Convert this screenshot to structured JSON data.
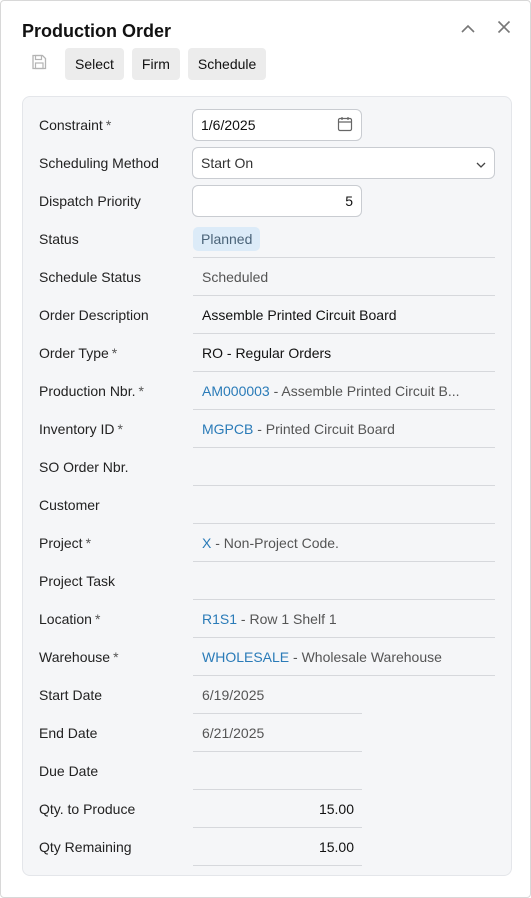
{
  "dialog": {
    "title": "Production Order"
  },
  "toolbar": {
    "select_label": "Select",
    "firm_label": "Firm",
    "schedule_label": "Schedule"
  },
  "form": {
    "constraint": {
      "label": "Constraint",
      "value": "1/6/2025"
    },
    "scheduling_method": {
      "label": "Scheduling Method",
      "value": "Start On"
    },
    "dispatch_priority": {
      "label": "Dispatch Priority",
      "value": "5"
    },
    "status": {
      "label": "Status",
      "value": "Planned"
    },
    "schedule_status": {
      "label": "Schedule Status",
      "value": "Scheduled"
    },
    "order_description": {
      "label": "Order Description",
      "value": "Assemble Printed Circuit Board"
    },
    "order_type": {
      "label": "Order Type",
      "value": "RO - Regular Orders"
    },
    "production_nbr": {
      "label": "Production Nbr.",
      "code": "AM000003",
      "desc": " - Assemble Printed Circuit B..."
    },
    "inventory_id": {
      "label": "Inventory ID",
      "code": "MGPCB",
      "desc": " - Printed Circuit Board"
    },
    "so_order_nbr": {
      "label": "SO Order Nbr.",
      "value": ""
    },
    "customer": {
      "label": "Customer",
      "value": ""
    },
    "project": {
      "label": "Project",
      "code": "X",
      "desc": " - Non-Project Code."
    },
    "project_task": {
      "label": "Project Task",
      "value": ""
    },
    "location": {
      "label": "Location",
      "code": "R1S1",
      "desc": " - Row 1 Shelf 1"
    },
    "warehouse": {
      "label": "Warehouse",
      "code": "WHOLESALE",
      "desc": " - Wholesale Warehouse"
    },
    "start_date": {
      "label": "Start Date",
      "value": "6/19/2025"
    },
    "end_date": {
      "label": "End Date",
      "value": "6/21/2025"
    },
    "due_date": {
      "label": "Due Date",
      "value": ""
    },
    "qty_to_produce": {
      "label": "Qty. to Produce",
      "value": "15.00"
    },
    "qty_remaining": {
      "label": "Qty Remaining",
      "value": "15.00"
    }
  },
  "required_marker": "*",
  "colors": {
    "link": "#2a7bb8",
    "badge_bg": "#dcebf8",
    "panel_bg": "#f5f6f8"
  },
  "icons": {
    "save": "floppy-disk-icon",
    "collapse": "chevron-up-icon",
    "close": "close-icon",
    "calendar": "calendar-icon",
    "dropdown": "chevron-down-icon"
  }
}
